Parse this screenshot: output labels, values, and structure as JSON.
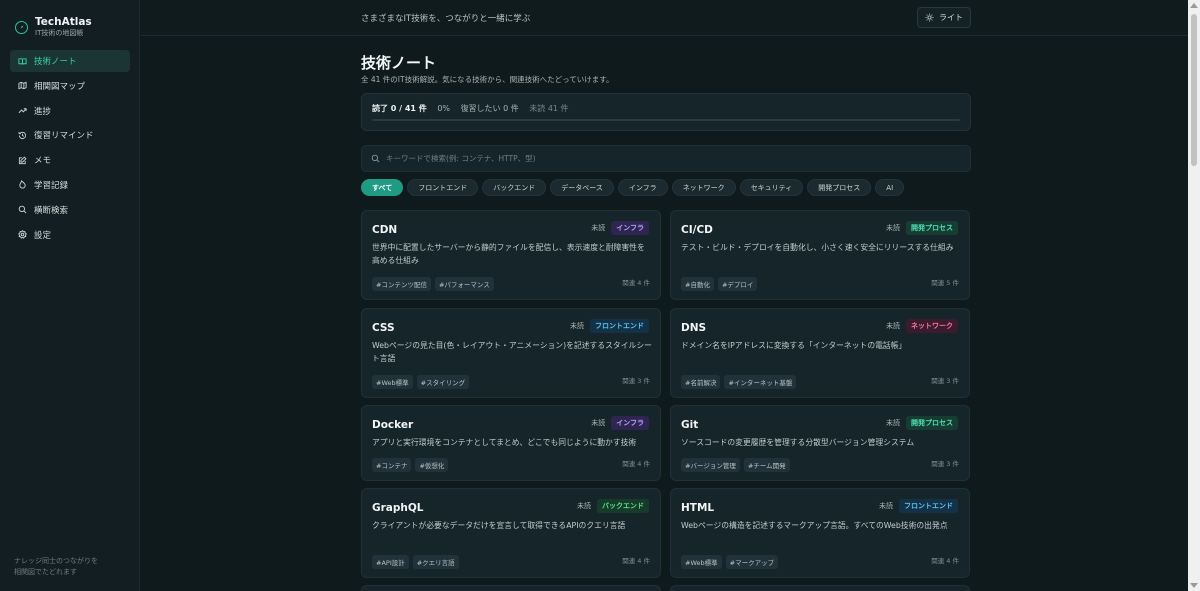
{
  "brand": {
    "name": "TechAtlas",
    "subtitle": "IT技術の地図帳"
  },
  "sidebar": {
    "items": [
      {
        "label": "技術ノート",
        "icon": "book-icon",
        "active": true
      },
      {
        "label": "相関図マップ",
        "icon": "map-icon",
        "active": false
      },
      {
        "label": "進捗",
        "icon": "trend-icon",
        "active": false
      },
      {
        "label": "復習リマインド",
        "icon": "history-icon",
        "active": false
      },
      {
        "label": "メモ",
        "icon": "note-icon",
        "active": false
      },
      {
        "label": "学習記録",
        "icon": "flame-icon",
        "active": false
      },
      {
        "label": "横断検索",
        "icon": "search-icon",
        "active": false
      },
      {
        "label": "設定",
        "icon": "gear-icon",
        "active": false
      }
    ],
    "footer_line1": "ナレッジ同士のつながりを",
    "footer_line2": "相関図でたどれます"
  },
  "header": {
    "tagline": "さまざまなIT技術を、つながりと一緒に学ぶ",
    "theme_label": "ライト",
    "theme_icon": "sun-icon"
  },
  "main": {
    "title": "技術ノート",
    "subtitle": "全 41 件のIT技術解説。気になる技術から、関連技術へたどっていけます。",
    "progress": {
      "read_label": "読了 0 / 41 件",
      "percent_label": "0%",
      "review_label": "復習したい 0 件",
      "unread_label": "未読 41 件",
      "fraction": 0
    },
    "search": {
      "placeholder": "キーワードで検索(例: コンテナ、HTTP、型)",
      "value": ""
    },
    "filters": [
      {
        "label": "すべて",
        "active": true
      },
      {
        "label": "フロントエンド",
        "active": false
      },
      {
        "label": "バックエンド",
        "active": false
      },
      {
        "label": "データベース",
        "active": false
      },
      {
        "label": "インフラ",
        "active": false
      },
      {
        "label": "ネットワーク",
        "active": false
      },
      {
        "label": "セキュリティ",
        "active": false
      },
      {
        "label": "開発プロセス",
        "active": false
      },
      {
        "label": "AI",
        "active": false
      }
    ],
    "status_label": "未読",
    "cards": [
      {
        "title": "CDN",
        "category": "インフラ",
        "desc": "世界中に配置したサーバーから静的ファイルを配信し、表示速度と耐障害性を高める仕組み",
        "tags": [
          "#コンテンツ配信",
          "#パフォーマンス"
        ],
        "related": "関連 4 件"
      },
      {
        "title": "CI/CD",
        "category": "開発プロセス",
        "desc": "テスト・ビルド・デプロイを自動化し、小さく速く安全にリリースする仕組み",
        "tags": [
          "#自動化",
          "#デプロイ"
        ],
        "related": "関連 5 件"
      },
      {
        "title": "CSS",
        "category": "フロントエンド",
        "desc": "Webページの見た目(色・レイアウト・アニメーション)を記述するスタイルシート言語",
        "tags": [
          "#Web標準",
          "#スタイリング"
        ],
        "related": "関連 3 件"
      },
      {
        "title": "DNS",
        "category": "ネットワーク",
        "desc": "ドメイン名をIPアドレスに変換する「インターネットの電話帳」",
        "tags": [
          "#名前解決",
          "#インターネット基盤"
        ],
        "related": "関連 3 件"
      },
      {
        "title": "Docker",
        "category": "インフラ",
        "desc": "アプリと実行環境をコンテナとしてまとめ、どこでも同じように動かす技術",
        "tags": [
          "#コンテナ",
          "#仮想化"
        ],
        "related": "関連 4 件"
      },
      {
        "title": "Git",
        "category": "開発プロセス",
        "desc": "ソースコードの変更履歴を管理する分散型バージョン管理システム",
        "tags": [
          "#バージョン管理",
          "#チーム開発"
        ],
        "related": "関連 3 件"
      },
      {
        "title": "GraphQL",
        "category": "バックエンド",
        "desc": "クライアントが必要なデータだけを宣言して取得できるAPIのクエリ言語",
        "tags": [
          "#API設計",
          "#クエリ言語"
        ],
        "related": "関連 4 件"
      },
      {
        "title": "HTML",
        "category": "フロントエンド",
        "desc": "Webページの構造を記述するマークアップ言語。すべてのWeb技術の出発点",
        "tags": [
          "#Web標準",
          "#マークアップ"
        ],
        "related": "関連 4 件"
      }
    ]
  },
  "colors": {
    "accent": "#2ec4a0",
    "infra_bg": "#2e2650",
    "infra_fg": "#b6a6ff",
    "devproc_bg": "#173d33",
    "devproc_fg": "#4fe0b4",
    "frontend_bg": "#143247",
    "frontend_fg": "#5fc3f2",
    "network_bg": "#3c1b2c",
    "network_fg": "#f07aa7",
    "backend_bg": "#173b2a",
    "backend_fg": "#5fe08a"
  }
}
